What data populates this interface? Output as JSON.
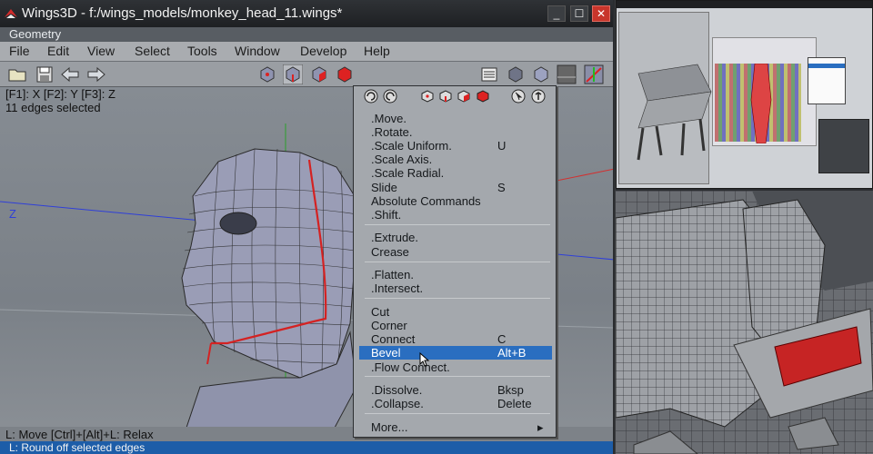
{
  "window": {
    "title": "Wings3D - f:/wings_models/monkey_head_11.wings*",
    "minimize": "_",
    "maximize": "☐",
    "close": "✕"
  },
  "geometry_label": "Geometry",
  "menubar": [
    "File",
    "Edit",
    "View",
    "Select",
    "Tools",
    "Window",
    "Develop",
    "Help"
  ],
  "viewport": {
    "fkeys": "[F1]: X  [F2]: Y  [F3]: Z",
    "selection_info": "11 edges selected",
    "axis_z": "Z"
  },
  "status": {
    "line1": "L: Move   [Ctrl]+[Alt]+L: Relax",
    "line2": "L: Round off selected edges"
  },
  "popup": {
    "items": [
      {
        "label": ".Move.",
        "shortcut": ""
      },
      {
        "label": ".Rotate.",
        "shortcut": ""
      },
      {
        "label": ".Scale Uniform.",
        "shortcut": "U"
      },
      {
        "label": ".Scale Axis.",
        "shortcut": ""
      },
      {
        "label": ".Scale Radial.",
        "shortcut": ""
      },
      {
        "label": "Slide",
        "shortcut": "S"
      },
      {
        "label": "Absolute Commands",
        "shortcut": ""
      },
      {
        "label": ".Shift.",
        "shortcut": ""
      },
      {
        "label": ".Extrude.",
        "shortcut": ""
      },
      {
        "label": "Crease",
        "shortcut": ""
      },
      {
        "label": ".Flatten.",
        "shortcut": ""
      },
      {
        "label": ".Intersect.",
        "shortcut": ""
      },
      {
        "label": "Cut",
        "shortcut": ""
      },
      {
        "label": "Corner",
        "shortcut": ""
      },
      {
        "label": "Connect",
        "shortcut": "C"
      },
      {
        "label": "Bevel",
        "shortcut": "Alt+B"
      },
      {
        "label": ".Flow Connect.",
        "shortcut": ""
      },
      {
        "label": ".Dissolve.",
        "shortcut": "Bksp"
      },
      {
        "label": ".Collapse.",
        "shortcut": "Delete"
      },
      {
        "label": "More...",
        "shortcut": "▸"
      }
    ],
    "highlighted": "Bevel"
  },
  "colors": {
    "selection_edge": "#d42222",
    "highlight": "#2a6ec0",
    "status_blue": "#1d5da8",
    "close_button": "#c8352b"
  }
}
